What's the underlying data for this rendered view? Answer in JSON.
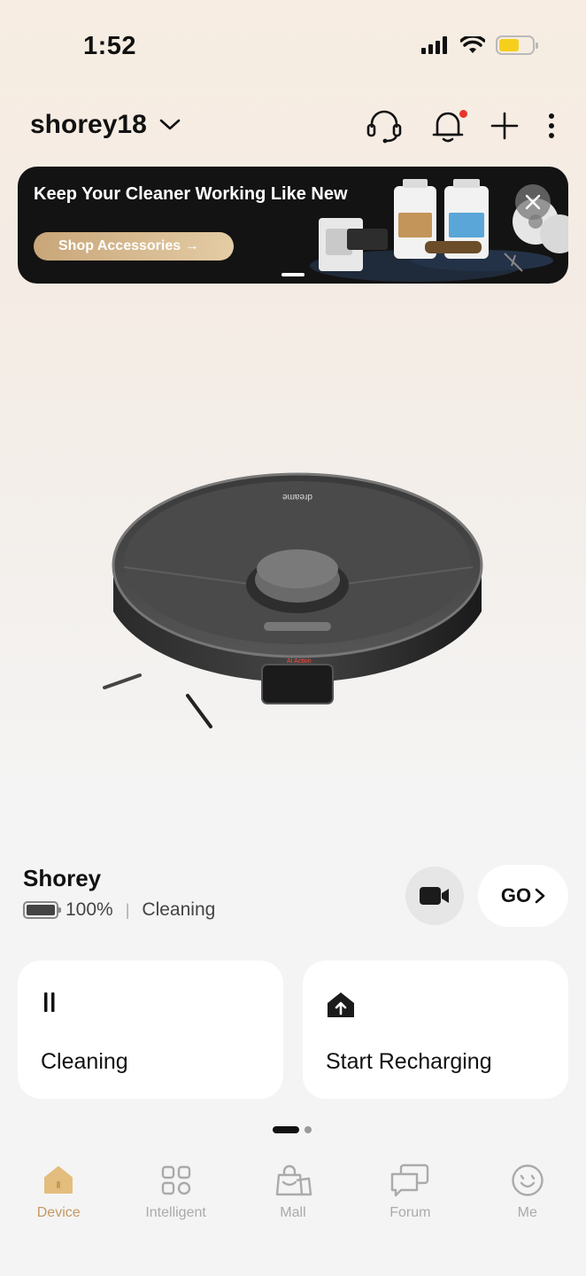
{
  "status_bar": {
    "time": "1:52"
  },
  "header": {
    "account_name": "shorey18"
  },
  "banner": {
    "title": "Keep Your Cleaner Working Like New",
    "button_label": "Shop Accessories →"
  },
  "device": {
    "name": "Shorey",
    "battery": "100%",
    "separator": "|",
    "status": "Cleaning",
    "go_label": "GO"
  },
  "actions": [
    {
      "label": "Cleaning",
      "icon": "pause-icon"
    },
    {
      "label": "Start Recharging",
      "icon": "recharge-home-icon"
    }
  ],
  "tabs": [
    {
      "label": "Device",
      "icon": "device-home-icon",
      "active": true
    },
    {
      "label": "Intelligent",
      "icon": "grid-icon",
      "active": false
    },
    {
      "label": "Mall",
      "icon": "shopping-bag-icon",
      "active": false
    },
    {
      "label": "Forum",
      "icon": "chat-bubbles-icon",
      "active": false
    },
    {
      "label": "Me",
      "icon": "smiley-face-icon",
      "active": false
    }
  ],
  "colors": {
    "accent": "#c29a63",
    "notification_dot": "#e8352b",
    "battery_status_fill": "#f6cf1c"
  }
}
